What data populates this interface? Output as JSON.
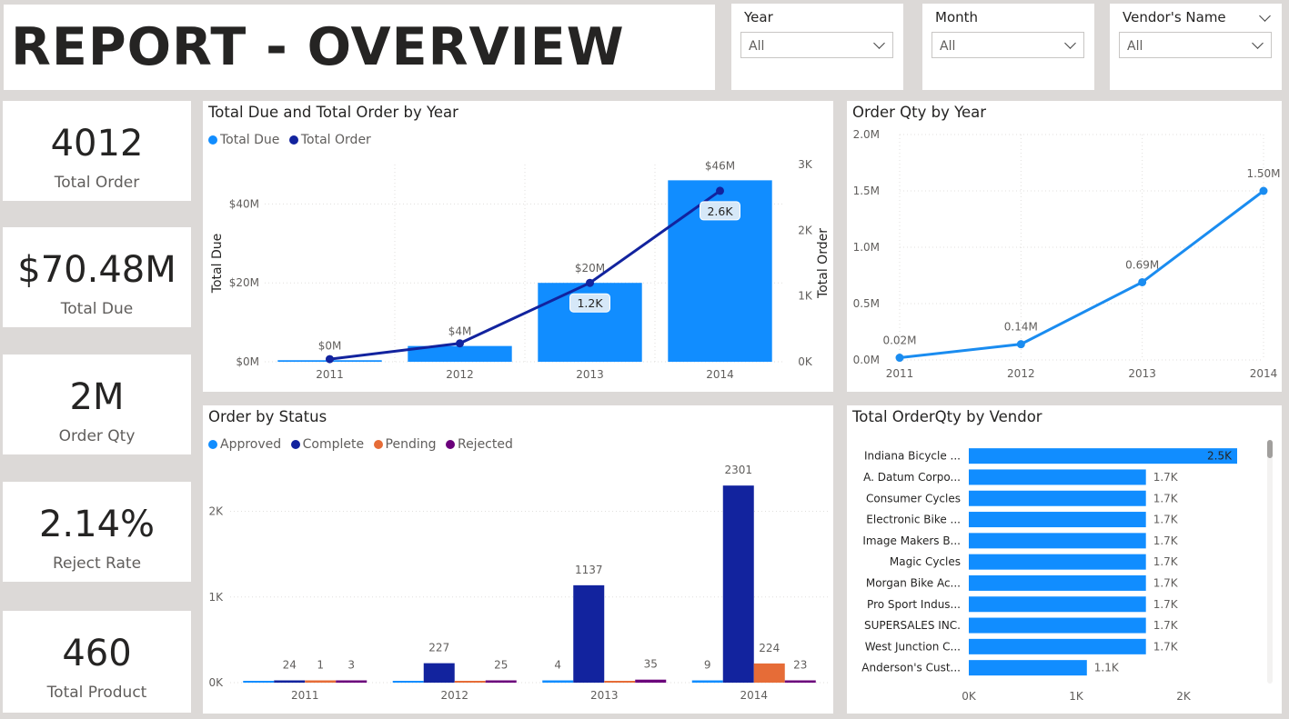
{
  "report_title": "REPORT - OVERVIEW",
  "slicers": [
    {
      "label": "Year",
      "value": "All"
    },
    {
      "label": "Month",
      "value": "All"
    },
    {
      "label": "Vendor's Name",
      "value": "All"
    }
  ],
  "kpis": [
    {
      "value": "4012",
      "label": "Total Order"
    },
    {
      "value": "$70.48M",
      "label": "Total Due"
    },
    {
      "value": "2M",
      "label": "Order Qty"
    },
    {
      "value": "2.14%",
      "label": "Reject Rate"
    },
    {
      "value": "460",
      "label": "Total Product"
    }
  ],
  "colors": {
    "blue": "#118dff",
    "navy": "#12239e",
    "orange": "#e66c37",
    "purple": "#6b007b",
    "line_blue": "#1a8cf0"
  },
  "chart_data": [
    {
      "type": "bar",
      "title": "Total Due and Total Order by Year",
      "categories": [
        "2011",
        "2012",
        "2013",
        "2014"
      ],
      "series": [
        {
          "name": "Total Due",
          "type": "bar",
          "axis": "left",
          "values": [
            0.4,
            4,
            20,
            46
          ],
          "data_labels": [
            "$0M",
            "$4M",
            "$20M",
            "$46M"
          ]
        },
        {
          "name": "Total Order",
          "type": "line",
          "axis": "right",
          "values": [
            40,
            280,
            1200,
            2600
          ],
          "data_labels": [
            "",
            "",
            "1.2K",
            "2.6K"
          ]
        }
      ],
      "ylabel": "Total Due",
      "y2label": "Total Order",
      "ylim": [
        0,
        50
      ],
      "yticks": [
        "$0M",
        "$20M",
        "$40M"
      ],
      "y2lim": [
        0,
        3000
      ],
      "y2ticks": [
        "0K",
        "1K",
        "2K",
        "3K"
      ],
      "legend": "top-left",
      "grid": true
    },
    {
      "type": "line",
      "title": "Order Qty by Year",
      "x": [
        "2011",
        "2012",
        "2013",
        "2014"
      ],
      "values": [
        0.02,
        0.14,
        0.69,
        1.5
      ],
      "data_labels": [
        "0.02M",
        "0.14M",
        "0.69M",
        "1.50M"
      ],
      "ylim": [
        0,
        2
      ],
      "yticks": [
        "0.0M",
        "0.5M",
        "1.0M",
        "1.5M",
        "2.0M"
      ],
      "grid": true
    },
    {
      "type": "bar",
      "title": "Order by Status",
      "categories": [
        "2011",
        "2012",
        "2013",
        "2014"
      ],
      "series": [
        {
          "name": "Approved",
          "values": [
            0,
            0,
            4,
            9
          ],
          "data_labels": [
            "",
            "",
            "4",
            "9"
          ]
        },
        {
          "name": "Complete",
          "values": [
            24,
            227,
            1137,
            2301
          ],
          "data_labels": [
            "24",
            "227",
            "1137",
            "2301"
          ]
        },
        {
          "name": "Pending",
          "values": [
            1,
            0,
            0,
            224
          ],
          "data_labels": [
            "1",
            "",
            "",
            "224"
          ]
        },
        {
          "name": "Rejected",
          "values": [
            3,
            25,
            35,
            23
          ],
          "data_labels": [
            "3",
            "25",
            "35",
            "23"
          ]
        }
      ],
      "ylim": [
        0,
        2600
      ],
      "yticks": [
        "0K",
        "1K",
        "2K"
      ],
      "legend": "top-left",
      "grid": true
    },
    {
      "type": "bar",
      "orientation": "horizontal",
      "title": "Total OrderQty by Vendor",
      "categories": [
        "Indiana Bicycle ...",
        "A. Datum Corpo...",
        "Consumer Cycles",
        "Electronic Bike ...",
        "Image Makers B...",
        "Magic Cycles",
        "Morgan Bike Ac...",
        "Pro Sport Indus...",
        "SUPERSALES INC.",
        "West Junction C...",
        "Anderson's Cust..."
      ],
      "values": [
        2500,
        1650,
        1650,
        1650,
        1650,
        1650,
        1650,
        1650,
        1650,
        1650,
        1100
      ],
      "data_labels": [
        "2.5K",
        "1.7K",
        "1.7K",
        "1.7K",
        "1.7K",
        "1.7K",
        "1.7K",
        "1.7K",
        "1.7K",
        "1.7K",
        "1.1K"
      ],
      "xlim": [
        0,
        2500
      ],
      "xticks": [
        "0K",
        "1K",
        "2K"
      ]
    }
  ]
}
